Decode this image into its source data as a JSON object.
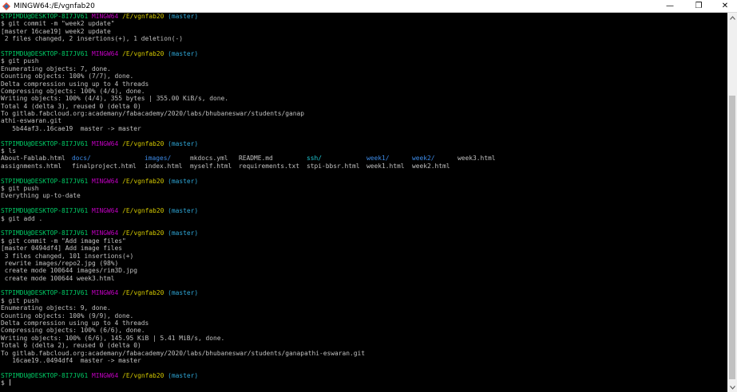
{
  "window": {
    "title": "MINGW64:/E/vgnfab20",
    "controls": {
      "minimize": "—",
      "maximize": "❐",
      "close": "✕"
    }
  },
  "colors": {
    "background": "#000000",
    "text": "#c0c0c0",
    "prompt_user": "#00cc66",
    "prompt_system": "#c000c0",
    "prompt_path": "#d3c800",
    "prompt_branch": "#2fa8d8",
    "directory": "#3d8be8",
    "symlink": "#1fc7d4"
  },
  "prompt": {
    "user_host": "STPIMDU@DESKTOP-8I7JV61",
    "system": "MINGW64",
    "path": "/E/vgnfab20",
    "branch": "(master)"
  },
  "terminal": {
    "block1": {
      "command": "$ git commit -m \"week2 update\"",
      "output": [
        "[master 16cae19] week2 update",
        " 2 files changed, 2 insertions(+), 1 deletion(-)"
      ]
    },
    "block2": {
      "command": "$ git push",
      "output": [
        "Enumerating objects: 7, done.",
        "Counting objects: 100% (7/7), done.",
        "Delta compression using up to 4 threads",
        "Compressing objects: 100% (4/4), done.",
        "Writing objects: 100% (4/4), 355 bytes | 355.00 KiB/s, done.",
        "Total 4 (delta 3), reused 0 (delta 0)",
        "To gitlab.fabcloud.org:academany/fabacademy/2020/labs/bhubaneswar/students/ganap",
        "athi-eswaran.git",
        "   5b44af3..16cae19  master -> master"
      ]
    },
    "block3": {
      "command": "$ ls",
      "ls_rows": [
        [
          {
            "text": "About-Fablab.html",
            "kind": "file"
          },
          {
            "text": "docs/",
            "kind": "dir"
          },
          {
            "text": "images/",
            "kind": "dir"
          },
          {
            "text": "mkdocs.yml",
            "kind": "file"
          },
          {
            "text": "README.md",
            "kind": "file"
          },
          {
            "text": "ssh/",
            "kind": "dir"
          },
          {
            "text": "week1/",
            "kind": "dir"
          },
          {
            "text": "week2/",
            "kind": "dir"
          },
          {
            "text": "week3.html",
            "kind": "file"
          }
        ],
        [
          {
            "text": "assignments.html",
            "kind": "file"
          },
          {
            "text": "finalproject.html",
            "kind": "file"
          },
          {
            "text": "index.html",
            "kind": "file"
          },
          {
            "text": "myself.html",
            "kind": "file"
          },
          {
            "text": "requirements.txt",
            "kind": "file"
          },
          {
            "text": "stpi-bbsr.html",
            "kind": "file"
          },
          {
            "text": "week1.html",
            "kind": "file"
          },
          {
            "text": "week2.html",
            "kind": "file"
          },
          {
            "text": "",
            "kind": "file"
          }
        ]
      ]
    },
    "block4": {
      "command": "$ git push",
      "output": [
        "Everything up-to-date"
      ]
    },
    "block5": {
      "command": "$ git add .",
      "output": []
    },
    "block6": {
      "command": "$ git commit -m \"Add image files\"",
      "output": [
        "[master 0494df4] Add image files",
        " 3 files changed, 101 insertions(+)",
        " rewrite images/repo2.jpg (98%)",
        " create mode 100644 images/rim3D.jpg",
        " create mode 100644 week3.html"
      ]
    },
    "block7": {
      "command": "$ git push",
      "output": [
        "Enumerating objects: 9, done.",
        "Counting objects: 100% (9/9), done.",
        "Delta compression using up to 4 threads",
        "Compressing objects: 100% (6/6), done.",
        "Writing objects: 100% (6/6), 145.95 KiB | 5.41 MiB/s, done.",
        "Total 6 (delta 2), reused 0 (delta 0)",
        "To gitlab.fabcloud.org:academany/fabacademy/2020/labs/bhubaneswar/students/ganapathi-eswaran.git",
        "   16cae19..0494df4  master -> master"
      ]
    },
    "final_prompt": "$ "
  }
}
